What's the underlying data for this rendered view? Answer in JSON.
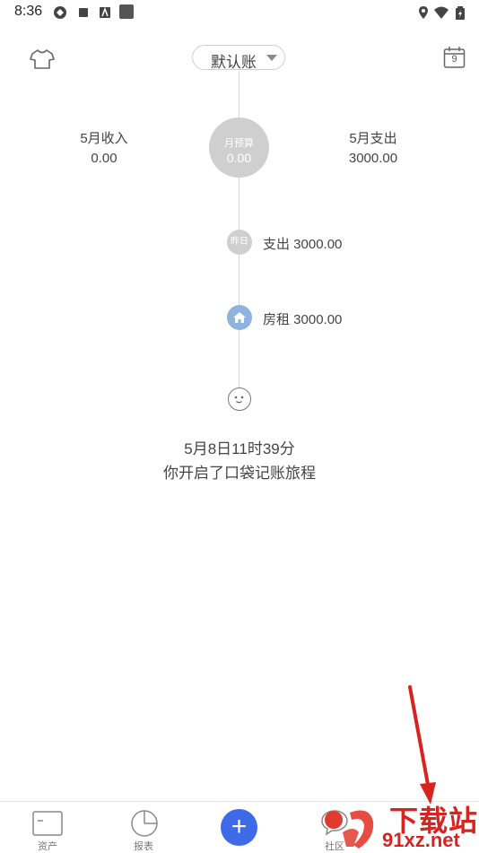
{
  "status_bar": {
    "time": "8:36"
  },
  "header": {
    "account": "默认账"
  },
  "summary": {
    "income_label": "5月收入",
    "income_value": "0.00",
    "budget_label": "月预算",
    "budget_value": "0.00",
    "expense_label": "5月支出",
    "expense_value": "3000.00"
  },
  "calendar": {
    "day": "9"
  },
  "timeline": [
    {
      "badge": "昨日",
      "text": "支出 3000.00"
    },
    {
      "icon": "home-icon",
      "text": "房租 3000.00"
    }
  ],
  "start": {
    "datetime": "5月8日11时39分",
    "message": "你开启了口袋记账旅程"
  },
  "bottom_nav": [
    {
      "label": "资产",
      "icon": "card-icon"
    },
    {
      "label": "报表",
      "icon": "pie-chart-icon"
    },
    {
      "label": "+",
      "icon": "plus-icon"
    },
    {
      "label": "社区",
      "icon": "chat-bubble-icon"
    }
  ],
  "watermark": {
    "line1": "下载站",
    "line2": "91xz.net"
  },
  "colors": {
    "accent": "#3d6ae6",
    "node_blue": "#8fb3df",
    "node_gray": "#cfcfcf",
    "arrow_red": "#d8231f"
  }
}
